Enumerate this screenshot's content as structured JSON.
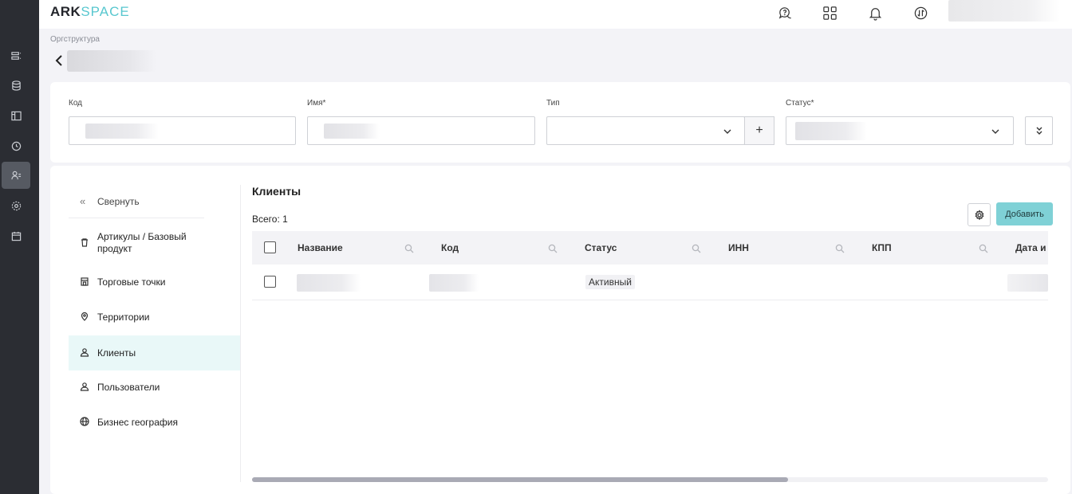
{
  "rail": {
    "items": [
      {
        "icon": "list-icon",
        "active": false
      },
      {
        "icon": "database-icon",
        "active": false
      },
      {
        "icon": "layout-icon",
        "active": false
      },
      {
        "icon": "clock-icon",
        "active": false
      },
      {
        "icon": "users-icon",
        "active": true
      },
      {
        "icon": "gear-icon",
        "active": false
      },
      {
        "icon": "calendar-icon",
        "active": false
      }
    ]
  },
  "header": {
    "logo_part1": "ARK",
    "logo_part2": "SPACE",
    "icons": [
      "support-chat-icon",
      "apps-grid-icon",
      "bell-icon",
      "sync-icon"
    ]
  },
  "breadcrumb": "Оргструктура",
  "form": {
    "code_label": "Код",
    "name_label": "Имя*",
    "type_label": "Тип",
    "status_label": "Статус*"
  },
  "sidemenu": {
    "collapse_label": "Свернуть",
    "items": [
      {
        "label": "Артикулы / Базовый продукт",
        "icon": "trash-icon"
      },
      {
        "label": "Торговые точки",
        "icon": "store-icon"
      },
      {
        "label": "Территории",
        "icon": "map-pin-icon"
      },
      {
        "label": "Клиенты",
        "icon": "user-icon"
      },
      {
        "label": "Пользователи",
        "icon": "user-icon"
      },
      {
        "label": "Бизнес география",
        "icon": "globe-icon"
      }
    ]
  },
  "content": {
    "title": "Клиенты",
    "total_label": "Всего: 1",
    "add_button": "Добавить"
  },
  "table": {
    "columns": [
      "Название",
      "Код",
      "Статус",
      "ИНН",
      "КПП",
      "Дата и"
    ],
    "rows": [
      {
        "status": "Активный"
      }
    ]
  },
  "colors": {
    "accent": "#7fd1d6",
    "rail_bg": "#2b2d33",
    "active_menu_bg": "#e9f8f8"
  }
}
